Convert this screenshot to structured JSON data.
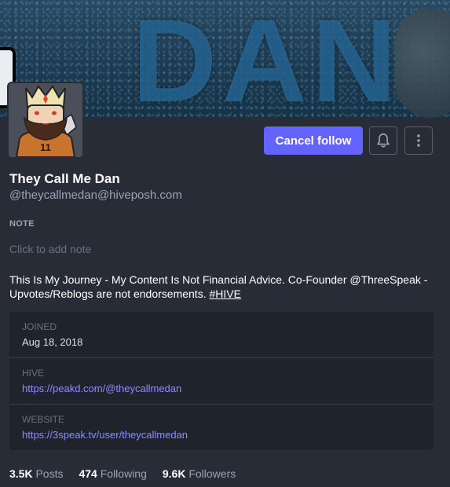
{
  "banner": {
    "text": "DAN"
  },
  "profile": {
    "display_name": "They Call Me Dan",
    "handle": "@theycallmedan@hiveposh.com",
    "avatar_number": "11"
  },
  "actions": {
    "follow_label": "Cancel follow",
    "bell_icon": "bell-icon",
    "menu_icon": "kebab-menu-icon"
  },
  "note": {
    "label": "NOTE",
    "placeholder": "Click to add note"
  },
  "bio": {
    "text": "This Is My Journey - My Content Is Not Financial Advice. Co-Founder @ThreeSpeak - Upvotes/Reblogs are not endorsements. ",
    "hashtag": "#HIVE"
  },
  "fields": [
    {
      "label": "JOINED",
      "value": "Aug 18, 2018"
    },
    {
      "label": "HIVE",
      "value": "https://peakd.com/@theycallmedan"
    },
    {
      "label": "WEBSITE",
      "value": "https://3speak.tv/user/theycallmedan"
    }
  ],
  "stats": [
    {
      "count": "3.5K",
      "label": "Posts"
    },
    {
      "count": "474",
      "label": "Following"
    },
    {
      "count": "9.6K",
      "label": "Followers"
    }
  ],
  "colors": {
    "background": "#282c37",
    "accent": "#6364ff",
    "link": "#8c8dff",
    "fields_bg": "#1f232b"
  }
}
